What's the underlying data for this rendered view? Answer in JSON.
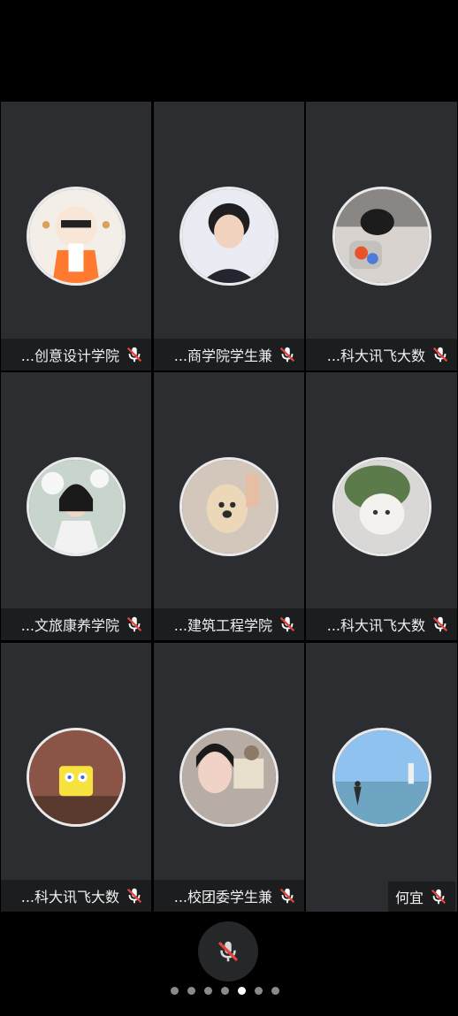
{
  "tiles": [
    {
      "name": "创意设计学院...",
      "display": "...创意设计学院",
      "avatar": "anime-girl-headphones"
    },
    {
      "name": "商学院学生兼...",
      "display": "...商学院学生兼",
      "avatar": "boy-portrait"
    },
    {
      "name": "科大讯飞大数...",
      "display": "...科大讯飞大数",
      "avatar": "person-with-snacks"
    },
    {
      "name": "文旅康养学院...",
      "display": "...文旅康养学院",
      "avatar": "girl-with-flowers"
    },
    {
      "name": "建筑工程学院...",
      "display": "...建筑工程学院",
      "avatar": "fluffy-dog"
    },
    {
      "name": "科大讯飞大数...",
      "display": "...科大讯飞大数",
      "avatar": "cat-with-leaf-hat"
    },
    {
      "name": "科大讯飞大数...",
      "display": "...科大讯飞大数",
      "avatar": "spongebob"
    },
    {
      "name": "校团委学生兼...",
      "display": "...校团委学生兼",
      "avatar": "selfie-girl"
    },
    {
      "name": "何宜",
      "display": "何宜",
      "avatar": "beach-person"
    }
  ],
  "pager": {
    "total": 7,
    "active_index": 4
  },
  "icons": {
    "muted_mic": "muted-mic-icon"
  },
  "colors": {
    "tile_bg": "#2b2d30",
    "bar_bg": "#1c1d1f",
    "muted_red": "#e0443e"
  }
}
